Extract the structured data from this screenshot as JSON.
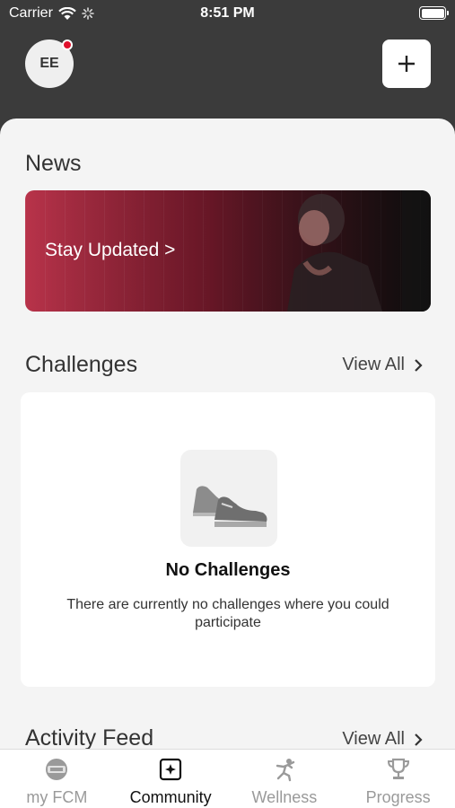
{
  "status_bar": {
    "carrier": "Carrier",
    "time": "8:51 PM",
    "icons": [
      "wifi-icon",
      "activity-spinner-icon",
      "battery-icon"
    ]
  },
  "header": {
    "avatar_initials": "EE",
    "notification_dot_color": "#e0102c",
    "add_icon": "plus-icon"
  },
  "news": {
    "title": "News",
    "banner_text": "Stay Updated >"
  },
  "challenges": {
    "title": "Challenges",
    "view_all": "View All",
    "empty_icon": "sneakers-icon",
    "empty_title": "No Challenges",
    "empty_description": "There are currently no challenges where you could participate"
  },
  "activity_feed": {
    "title": "Activity Feed",
    "view_all": "View All"
  },
  "tabs": [
    {
      "label": "my FCM",
      "icon": "fcm-logo-icon",
      "active": false
    },
    {
      "label": "Community",
      "icon": "community-icon",
      "active": true
    },
    {
      "label": "Wellness",
      "icon": "wellness-icon",
      "active": false
    },
    {
      "label": "Progress",
      "icon": "trophy-icon",
      "active": false
    }
  ],
  "colors": {
    "header_bg": "#3b3b3b",
    "accent": "#e0102c",
    "sheet_bg": "#f4f4f4"
  }
}
